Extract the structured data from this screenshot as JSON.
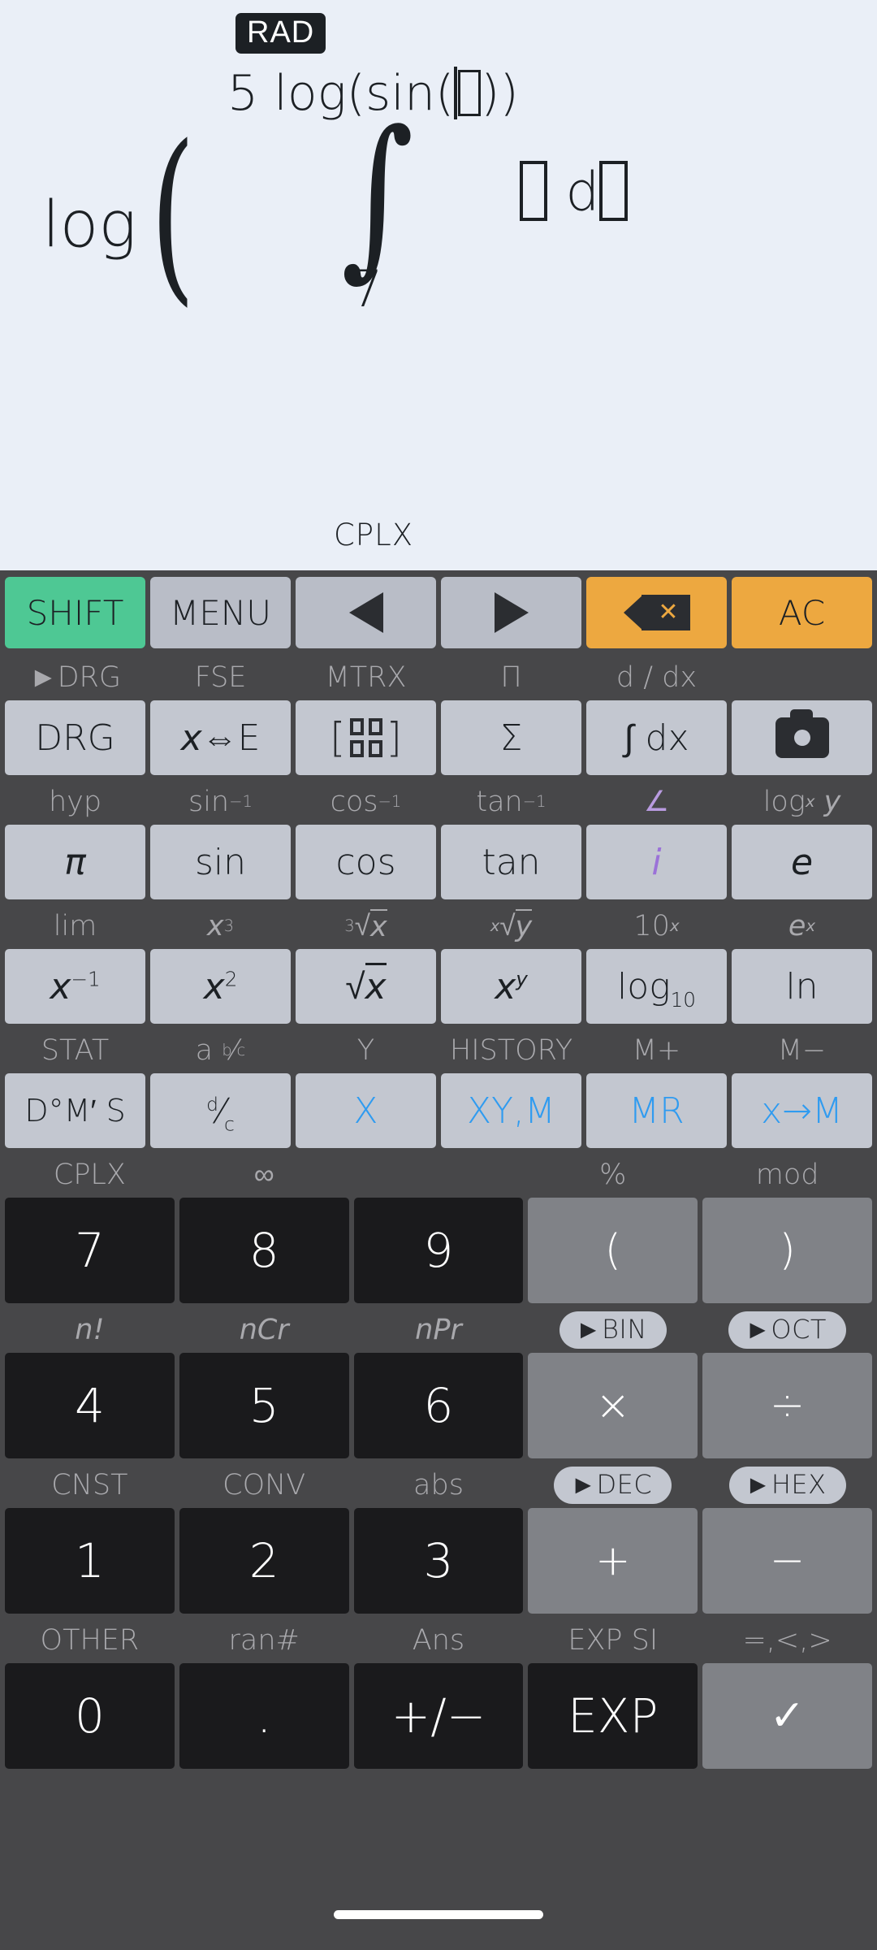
{
  "display": {
    "angle_mode_badge": "RAD",
    "expression": {
      "outer_function": "log",
      "open_paren": "(",
      "integral_symbol": "∫",
      "upper_limit": "5 log(sin(□))",
      "upper_limit_prefix": "5 log(sin(",
      "upper_limit_suffix": "))",
      "lower_limit": "7",
      "integrand": "□ d□",
      "integrand_d": "d"
    },
    "status_indicator": "CPLX"
  },
  "keypad": {
    "top_row": [
      {
        "label": "SHIFT",
        "style": "green",
        "icon": null
      },
      {
        "label": "MENU",
        "style": "grey",
        "icon": null
      },
      {
        "label": "",
        "style": "grey",
        "icon": "arrow-left-icon"
      },
      {
        "label": "",
        "style": "grey",
        "icon": "arrow-right-icon"
      },
      {
        "label": "",
        "style": "orange",
        "icon": "backspace-delete-icon"
      },
      {
        "label": "AC",
        "style": "orange",
        "icon": null
      }
    ],
    "rows": [
      {
        "name": "row-functions-1",
        "keys": [
          {
            "secondary": "►DRG",
            "secondary_style": "plain",
            "primary": "DRG",
            "style": "fn"
          },
          {
            "secondary": "FSE",
            "secondary_style": "plain",
            "primary": "x⇔E",
            "style": "fn"
          },
          {
            "secondary": "MTRX",
            "secondary_style": "plain",
            "primary": "",
            "style": "fn",
            "icon": "matrix-icon"
          },
          {
            "secondary": "Π",
            "secondary_style": "plain",
            "primary": "Σ",
            "style": "fn"
          },
          {
            "secondary": "d / dx",
            "secondary_style": "plain",
            "primary": "∫ dx",
            "style": "fn"
          },
          {
            "secondary": "",
            "secondary_style": "plain",
            "primary": "",
            "style": "camera",
            "icon": "camera-icon"
          }
        ]
      },
      {
        "name": "row-trig",
        "keys": [
          {
            "secondary": "hyp",
            "secondary_style": "plain",
            "primary": "π",
            "style": "fn"
          },
          {
            "secondary": "sin⁻¹",
            "secondary_style": "plain",
            "primary": "sin",
            "style": "fn"
          },
          {
            "secondary": "cos⁻¹",
            "secondary_style": "plain",
            "primary": "cos",
            "style": "fn"
          },
          {
            "secondary": "tan⁻¹",
            "secondary_style": "plain",
            "primary": "tan",
            "style": "fn"
          },
          {
            "secondary": "∠",
            "secondary_style": "violet",
            "primary": "i",
            "style": "fn violet"
          },
          {
            "secondary": "logₓ y",
            "secondary_style": "plain",
            "primary": "e",
            "style": "fn"
          }
        ]
      },
      {
        "name": "row-powers",
        "keys": [
          {
            "secondary": "lim",
            "secondary_style": "plain",
            "primary": "x⁻¹",
            "style": "fn"
          },
          {
            "secondary": "x³",
            "secondary_style": "plain",
            "primary": "x²",
            "style": "fn"
          },
          {
            "secondary": "³√x",
            "secondary_style": "plain",
            "primary": "√x",
            "style": "fn"
          },
          {
            "secondary": "ˣ√y",
            "secondary_style": "plain",
            "primary": "xʸ",
            "style": "fn"
          },
          {
            "secondary": "10ˣ",
            "secondary_style": "plain",
            "primary": "log₁₀",
            "style": "fn"
          },
          {
            "secondary": "eˣ",
            "secondary_style": "plain",
            "primary": "ln",
            "style": "fn"
          }
        ]
      },
      {
        "name": "row-memory",
        "keys": [
          {
            "secondary": "STAT",
            "secondary_style": "plain",
            "primary": "D°M′ S",
            "style": "fn"
          },
          {
            "secondary": "a b/c",
            "secondary_style": "plain",
            "primary": "d/c",
            "style": "fn"
          },
          {
            "secondary": "Y",
            "secondary_style": "plain",
            "primary": "X",
            "style": "fn blue"
          },
          {
            "secondary": "HISTORY",
            "secondary_style": "plain",
            "primary": "XY,M",
            "style": "fn blue"
          },
          {
            "secondary": "M+",
            "secondary_style": "plain",
            "primary": "MR",
            "style": "fn blue"
          },
          {
            "secondary": "M−",
            "secondary_style": "plain",
            "primary": "x→M",
            "style": "fn blue"
          }
        ]
      },
      {
        "name": "row-789",
        "keys": [
          {
            "secondary": "CPLX",
            "secondary_style": "plain",
            "primary": "7",
            "style": "num"
          },
          {
            "secondary": "∞",
            "secondary_style": "plain",
            "primary": "8",
            "style": "num"
          },
          {
            "secondary": "",
            "secondary_style": "plain",
            "primary": "9",
            "style": "num"
          },
          {
            "secondary": "%",
            "secondary_style": "plain",
            "primary": "(",
            "style": "op"
          },
          {
            "secondary": "mod",
            "secondary_style": "plain",
            "primary": ")",
            "style": "op"
          }
        ]
      },
      {
        "name": "row-456",
        "keys": [
          {
            "secondary": "n!",
            "secondary_style": "italic",
            "primary": "4",
            "style": "num"
          },
          {
            "secondary": "nCr",
            "secondary_style": "italic",
            "primary": "5",
            "style": "num"
          },
          {
            "secondary": "nPr",
            "secondary_style": "italic",
            "primary": "6",
            "style": "num"
          },
          {
            "secondary": "►BIN",
            "secondary_style": "pill",
            "primary": "×",
            "style": "op"
          },
          {
            "secondary": "►OCT",
            "secondary_style": "pill",
            "primary": "÷",
            "style": "op"
          }
        ]
      },
      {
        "name": "row-123",
        "keys": [
          {
            "secondary": "CNST",
            "secondary_style": "plain",
            "primary": "1",
            "style": "num"
          },
          {
            "secondary": "CONV",
            "secondary_style": "plain",
            "primary": "2",
            "style": "num"
          },
          {
            "secondary": "abs",
            "secondary_style": "plain",
            "primary": "3",
            "style": "num"
          },
          {
            "secondary": "►DEC",
            "secondary_style": "pill",
            "primary": "+",
            "style": "op"
          },
          {
            "secondary": "►HEX",
            "secondary_style": "pill",
            "primary": "−",
            "style": "op"
          }
        ]
      },
      {
        "name": "row-0",
        "keys": [
          {
            "secondary": "OTHER",
            "secondary_style": "plain",
            "primary": "0",
            "style": "num"
          },
          {
            "secondary": "ran#",
            "secondary_style": "plain",
            "primary": ".",
            "style": "num"
          },
          {
            "secondary": "Ans",
            "secondary_style": "plain",
            "primary": "+/−",
            "style": "num"
          },
          {
            "secondary": "EXP SI",
            "secondary_style": "plain",
            "primary": "EXP",
            "style": "num"
          },
          {
            "secondary": "=,<,>",
            "secondary_style": "plain",
            "primary": "✓",
            "style": "op"
          }
        ]
      }
    ]
  },
  "colors": {
    "display_bg": "#eaeff7",
    "keypad_bg": "#474749",
    "shift_green": "#4ec894",
    "orange": "#eda840",
    "fn_key": "#c3c7d0",
    "num_key": "#1a1a1c",
    "op_key": "#808287",
    "memory_blue": "#2f9bf0",
    "complex_violet": "#9b72d8",
    "secondary_label": "#a9a9ad"
  }
}
